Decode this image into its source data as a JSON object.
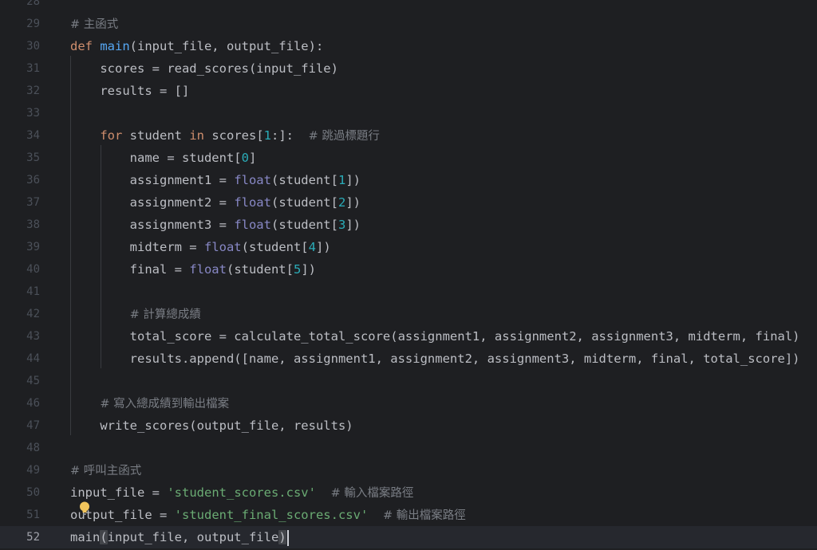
{
  "editor": {
    "language": "python",
    "current_line": "52",
    "lines": [
      {
        "num": "28",
        "tokens": []
      },
      {
        "num": "29",
        "tokens": [
          {
            "t": "cm",
            "v": "# 主函式"
          }
        ]
      },
      {
        "num": "30",
        "tokens": [
          {
            "t": "kw",
            "v": "def "
          },
          {
            "t": "fn",
            "v": "main"
          },
          {
            "t": "p",
            "v": "(input_file, output_file):"
          }
        ]
      },
      {
        "num": "31",
        "tokens": [
          {
            "t": "p",
            "v": "    scores = read_scores(input_file)"
          }
        ]
      },
      {
        "num": "32",
        "tokens": [
          {
            "t": "p",
            "v": "    results = []"
          }
        ]
      },
      {
        "num": "33",
        "tokens": []
      },
      {
        "num": "34",
        "tokens": [
          {
            "t": "p",
            "v": "    "
          },
          {
            "t": "kw",
            "v": "for"
          },
          {
            "t": "p",
            "v": " student "
          },
          {
            "t": "kw",
            "v": "in"
          },
          {
            "t": "p",
            "v": " scores["
          },
          {
            "t": "num",
            "v": "1"
          },
          {
            "t": "p",
            "v": ":]:  "
          },
          {
            "t": "cm",
            "v": "# 跳過標題行"
          }
        ]
      },
      {
        "num": "35",
        "tokens": [
          {
            "t": "p",
            "v": "        name = student["
          },
          {
            "t": "num",
            "v": "0"
          },
          {
            "t": "p",
            "v": "]"
          }
        ]
      },
      {
        "num": "36",
        "tokens": [
          {
            "t": "p",
            "v": "        assignment1 = "
          },
          {
            "t": "bi",
            "v": "float"
          },
          {
            "t": "p",
            "v": "(student["
          },
          {
            "t": "num",
            "v": "1"
          },
          {
            "t": "p",
            "v": "])"
          }
        ]
      },
      {
        "num": "37",
        "tokens": [
          {
            "t": "p",
            "v": "        assignment2 = "
          },
          {
            "t": "bi",
            "v": "float"
          },
          {
            "t": "p",
            "v": "(student["
          },
          {
            "t": "num",
            "v": "2"
          },
          {
            "t": "p",
            "v": "])"
          }
        ]
      },
      {
        "num": "38",
        "tokens": [
          {
            "t": "p",
            "v": "        assignment3 = "
          },
          {
            "t": "bi",
            "v": "float"
          },
          {
            "t": "p",
            "v": "(student["
          },
          {
            "t": "num",
            "v": "3"
          },
          {
            "t": "p",
            "v": "])"
          }
        ]
      },
      {
        "num": "39",
        "tokens": [
          {
            "t": "p",
            "v": "        midterm = "
          },
          {
            "t": "bi",
            "v": "float"
          },
          {
            "t": "p",
            "v": "(student["
          },
          {
            "t": "num",
            "v": "4"
          },
          {
            "t": "p",
            "v": "])"
          }
        ]
      },
      {
        "num": "40",
        "tokens": [
          {
            "t": "p",
            "v": "        final = "
          },
          {
            "t": "bi",
            "v": "float"
          },
          {
            "t": "p",
            "v": "(student["
          },
          {
            "t": "num",
            "v": "5"
          },
          {
            "t": "p",
            "v": "])"
          }
        ]
      },
      {
        "num": "41",
        "tokens": []
      },
      {
        "num": "42",
        "tokens": [
          {
            "t": "p",
            "v": "        "
          },
          {
            "t": "cm",
            "v": "# 計算總成績"
          }
        ]
      },
      {
        "num": "43",
        "tokens": [
          {
            "t": "p",
            "v": "        total_score = calculate_total_score(assignment1, assignment2, assignment3, midterm, final)"
          }
        ]
      },
      {
        "num": "44",
        "tokens": [
          {
            "t": "p",
            "v": "        results.append([name, assignment1, assignment2, assignment3, midterm, final, total_score])"
          }
        ]
      },
      {
        "num": "45",
        "tokens": []
      },
      {
        "num": "46",
        "tokens": [
          {
            "t": "p",
            "v": "    "
          },
          {
            "t": "cm",
            "v": "# 寫入總成績到輸出檔案"
          }
        ]
      },
      {
        "num": "47",
        "tokens": [
          {
            "t": "p",
            "v": "    write_scores(output_file, results)"
          }
        ]
      },
      {
        "num": "48",
        "tokens": []
      },
      {
        "num": "49",
        "tokens": [
          {
            "t": "cm",
            "v": "# 呼叫主函式"
          }
        ]
      },
      {
        "num": "50",
        "tokens": [
          {
            "t": "p",
            "v": "input_file = "
          },
          {
            "t": "str",
            "v": "'student_scores.csv'"
          },
          {
            "t": "p",
            "v": "  "
          },
          {
            "t": "cm",
            "v": "# 輸入檔案路徑"
          }
        ]
      },
      {
        "num": "51",
        "tokens": [
          {
            "t": "p",
            "v": "output_file = "
          },
          {
            "t": "str",
            "v": "'student_final_scores.csv'"
          },
          {
            "t": "p",
            "v": "  "
          },
          {
            "t": "cm",
            "v": "# 輸出檔案路徑"
          }
        ]
      },
      {
        "num": "52",
        "tokens": [
          {
            "t": "p",
            "v": "main"
          },
          {
            "t": "ph",
            "v": "("
          },
          {
            "t": "p",
            "v": "input_file, output_file"
          },
          {
            "t": "ph",
            "v": ")"
          },
          {
            "t": "caret",
            "v": ""
          }
        ]
      }
    ]
  },
  "icons": {
    "intention_bulb": "lightbulb-icon",
    "bulb_color": "#f2c55c"
  }
}
